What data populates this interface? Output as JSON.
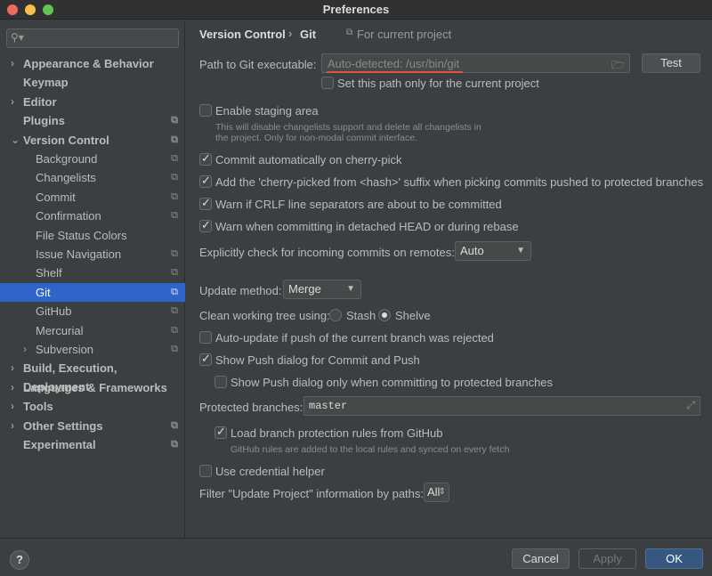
{
  "window": {
    "title": "Preferences"
  },
  "search": {
    "icon": "search-icon",
    "value": ""
  },
  "sidebar": {
    "items": [
      {
        "label": "Appearance & Behavior",
        "bold": true,
        "arrow": "›",
        "indent": 0,
        "project": false
      },
      {
        "label": "Keymap",
        "bold": true,
        "arrow": "",
        "indent": 0,
        "project": false
      },
      {
        "label": "Editor",
        "bold": true,
        "arrow": "›",
        "indent": 0,
        "project": false
      },
      {
        "label": "Plugins",
        "bold": true,
        "arrow": "",
        "indent": 0,
        "project": true
      },
      {
        "label": "Version Control",
        "bold": true,
        "arrow": "⌄",
        "indent": 0,
        "project": true
      },
      {
        "label": "Background",
        "bold": false,
        "arrow": "",
        "indent": 1,
        "project": true
      },
      {
        "label": "Changelists",
        "bold": false,
        "arrow": "",
        "indent": 1,
        "project": true
      },
      {
        "label": "Commit",
        "bold": false,
        "arrow": "",
        "indent": 1,
        "project": true
      },
      {
        "label": "Confirmation",
        "bold": false,
        "arrow": "",
        "indent": 1,
        "project": true
      },
      {
        "label": "File Status Colors",
        "bold": false,
        "arrow": "",
        "indent": 1,
        "project": false
      },
      {
        "label": "Issue Navigation",
        "bold": false,
        "arrow": "",
        "indent": 1,
        "project": true
      },
      {
        "label": "Shelf",
        "bold": false,
        "arrow": "",
        "indent": 1,
        "project": true
      },
      {
        "label": "Git",
        "bold": false,
        "arrow": "",
        "indent": 1,
        "project": true,
        "selected": true
      },
      {
        "label": "GitHub",
        "bold": false,
        "arrow": "",
        "indent": 1,
        "project": true
      },
      {
        "label": "Mercurial",
        "bold": false,
        "arrow": "",
        "indent": 1,
        "project": true
      },
      {
        "label": "Subversion",
        "bold": false,
        "arrow": "›",
        "indent": 1,
        "project": true
      },
      {
        "label": "Build, Execution, Deployment",
        "bold": true,
        "arrow": "›",
        "indent": 0,
        "project": false
      },
      {
        "label": "Languages & Frameworks",
        "bold": true,
        "arrow": "›",
        "indent": 0,
        "project": false
      },
      {
        "label": "Tools",
        "bold": true,
        "arrow": "›",
        "indent": 0,
        "project": false
      },
      {
        "label": "Other Settings",
        "bold": true,
        "arrow": "›",
        "indent": 0,
        "project": true
      },
      {
        "label": "Experimental",
        "bold": true,
        "arrow": "",
        "indent": 0,
        "project": true
      }
    ]
  },
  "breadcrumb": {
    "parent": "Version Control",
    "separator": "›",
    "current": "Git",
    "scope": "For current project",
    "scope_icon": "copy-icon"
  },
  "git": {
    "path_label": "Path to Git executable:",
    "path_placeholder": "Auto-detected: /usr/bin/git",
    "test_label": "Test",
    "set_path_only_label": "Set this path only for the current project",
    "set_path_only_checked": false,
    "staging_label": "Enable staging area",
    "staging_checked": false,
    "staging_note_1": "This will disable changelists support and delete all changelists in",
    "staging_note_2": "the project. Only for non-modal commit interface.",
    "cherry_pick_label": "Commit automatically on cherry-pick",
    "cherry_pick_checked": true,
    "suffix_label": "Add the 'cherry-picked from <hash>' suffix when picking commits pushed to protected branches",
    "suffix_checked": true,
    "crlf_label": "Warn if CRLF line separators are about to be committed",
    "crlf_checked": true,
    "detached_label": "Warn when committing in detached HEAD or during rebase",
    "detached_checked": true,
    "incoming_label": "Explicitly check for incoming commits on remotes:",
    "incoming_value": "Auto",
    "update_method_label": "Update method:",
    "update_method_value": "Merge",
    "clean_tree_label": "Clean working tree using:",
    "stash_label": "Stash",
    "shelve_label": "Shelve",
    "clean_selected": "Shelve",
    "auto_update_label": "Auto-update if push of the current branch was rejected",
    "auto_update_checked": false,
    "show_push_label": "Show Push dialog for Commit and Push",
    "show_push_checked": true,
    "show_push_protected_label": "Show Push dialog only when committing to protected branches",
    "show_push_protected_checked": false,
    "protected_label": "Protected branches:",
    "protected_value": "master",
    "load_rules_label": "Load branch protection rules from GitHub",
    "load_rules_checked": true,
    "load_rules_note": "GitHub rules are added to the local rules and synced on every fetch",
    "credential_label": "Use credential helper",
    "credential_checked": false,
    "filter_label": "Filter \"Update Project\" information by paths:",
    "filter_value": "All"
  },
  "footer": {
    "help": "?",
    "cancel": "Cancel",
    "apply": "Apply",
    "ok": "OK"
  },
  "colors": {
    "selection": "#2f65ca",
    "primary_button": "#365880",
    "error_underline": "#e0533d"
  }
}
